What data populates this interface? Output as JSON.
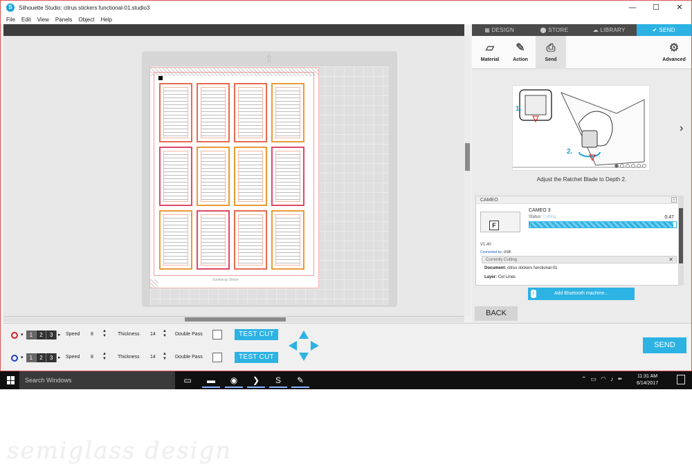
{
  "window": {
    "title": "Silhouette Studio: citrus stickers functional-01.studio3",
    "app_icon_letter": "S",
    "controls": [
      "—",
      "☐",
      "✕"
    ]
  },
  "menu": [
    "File",
    "Edit",
    "View",
    "Panels",
    "Object",
    "Help"
  ],
  "top_tabs": [
    {
      "label": "DESIGN",
      "icon": "grid-icon"
    },
    {
      "label": "STORE",
      "icon": "store-icon"
    },
    {
      "label": "LIBRARY",
      "icon": "cloud-icon"
    },
    {
      "label": "SEND",
      "icon": "check-icon",
      "active": true
    }
  ],
  "sub_tabs": {
    "material": "Material",
    "action": "Action",
    "send": "Send",
    "advanced": "Advanced"
  },
  "illustration": {
    "step1": "1.",
    "step2": "2.",
    "caption": "Adjust the Ratchet Blade to Depth 2.",
    "dots_total": 6,
    "dots_active": 1
  },
  "machine_panel": {
    "header": "CAMEO",
    "name": "CAMEO 3",
    "status_label": "Status:",
    "status_value": "Cutting",
    "time_remaining": "0:47",
    "progress": 0.98,
    "version": "V1.40",
    "connected_label": "Connected by:",
    "connected_value": "USB",
    "currently": "Currently Cutting",
    "document_label": "Document:",
    "document_value": "citrus stickers functional-01",
    "layer_label": "Layer:",
    "layer_value": "Cut Lines",
    "machine_letter": "F"
  },
  "bluetooth_button": "Add Bluetooth machine...",
  "back_button": "BACK",
  "page_footer_text": "Suoitseup Stotse",
  "sticker_colors": [
    "red",
    "red",
    "red",
    "orange",
    "pink",
    "orange",
    "orange",
    "pink",
    "orange",
    "pink",
    "red",
    "orange"
  ],
  "tools": [
    {
      "color": "#d02020",
      "holder_nums": [
        "1",
        "2",
        "3"
      ],
      "active_num": 0,
      "speed_label": "Speed",
      "speed_value": "8",
      "thickness_label": "Thickness",
      "thickness_value": "14",
      "double_pass_label": "Double Pass",
      "test_cut_label": "TEST CUT"
    },
    {
      "color": "#1a3ec7",
      "holder_nums": [
        "1",
        "2",
        "3"
      ],
      "active_num": 0,
      "speed_label": "Speed",
      "speed_value": "8",
      "thickness_label": "Thickness",
      "thickness_value": "14",
      "double_pass_label": "Double Pass",
      "test_cut_label": "TEST CUT"
    }
  ],
  "send_button": "SEND",
  "taskbar": {
    "search_placeholder": "Search Windows",
    "time": "11:31 AM",
    "date": "6/14/2017"
  },
  "watermark": "semiglass design",
  "colors": {
    "accent": "#2cb2e3",
    "dark": "#3e3e3e",
    "tool1": "#d02020",
    "tool2": "#1a3ec7"
  }
}
